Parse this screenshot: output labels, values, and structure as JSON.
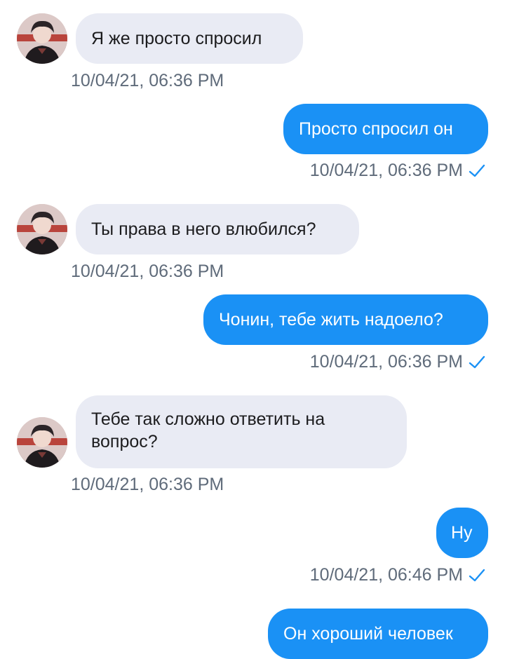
{
  "messages": [
    {
      "dir": "in",
      "text": "Я же просто спросил",
      "time": "10/04/21, 06:36 PM"
    },
    {
      "dir": "out",
      "text": "Просто спросил он",
      "time": "10/04/21, 06:36 PM"
    },
    {
      "dir": "in",
      "text": "Ты права в него влюбился?",
      "time": "10/04/21, 06:36 PM"
    },
    {
      "dir": "out",
      "text": "Чонин, тебе жить надоело?",
      "time": "10/04/21, 06:36 PM"
    },
    {
      "dir": "in",
      "text": "Тебе так сложно ответить на вопрос?",
      "time": "10/04/21, 06:36 PM"
    },
    {
      "dir": "out",
      "text": "Ну",
      "time": "10/04/21, 06:46 PM"
    },
    {
      "dir": "out",
      "text": "Он хороший человек",
      "time": ""
    }
  ],
  "colors": {
    "incoming_bubble": "#e9ebf4",
    "outgoing_bubble": "#1a91f5",
    "timestamp": "#5f6b7a",
    "read_check": "#1a91f5"
  },
  "icons": {
    "avatar": "user-avatar-photo",
    "read_receipt": "check-icon"
  }
}
